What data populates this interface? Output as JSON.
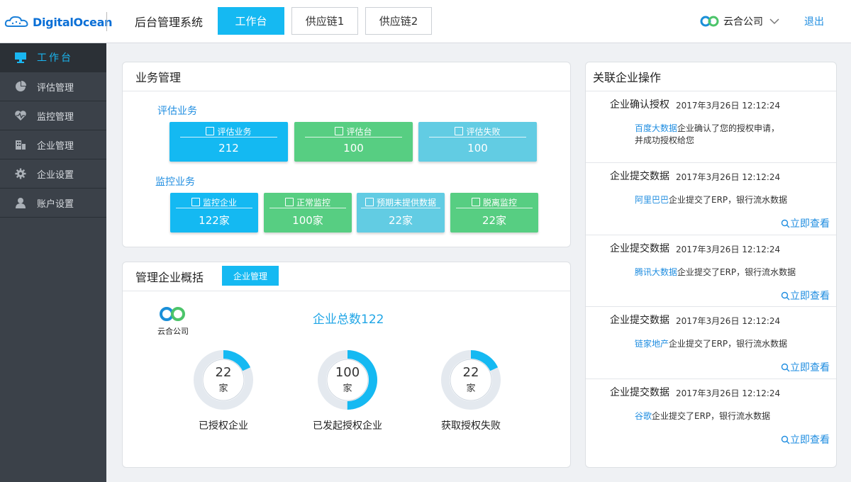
{
  "header": {
    "logo_text": "DigitalOcean",
    "system_title": "后台管理系统",
    "tabs": [
      "工作台",
      "供应链1",
      "供应链2"
    ],
    "company": "云合公司",
    "logout": "退出"
  },
  "sidebar": {
    "items": [
      {
        "label": "工作台",
        "icon": "monitor-icon"
      },
      {
        "label": "评估管理",
        "icon": "pie-chart-icon"
      },
      {
        "label": "监控管理",
        "icon": "heart-pulse-icon"
      },
      {
        "label": "企业管理",
        "icon": "building-icon"
      },
      {
        "label": "企业设置",
        "icon": "gear-icon"
      },
      {
        "label": "账户设置",
        "icon": "user-icon"
      }
    ]
  },
  "business": {
    "title": "业务管理",
    "eval_label": "评估业务",
    "eval_tiles": [
      {
        "label": "评估业务",
        "value": "212"
      },
      {
        "label": "评估台",
        "value": "100"
      },
      {
        "label": "评估失败",
        "value": "100"
      }
    ],
    "monitor_label": "监控业务",
    "monitor_tiles": [
      {
        "label": "监控企业",
        "value": "122家"
      },
      {
        "label": "正常监控",
        "value": "100家"
      },
      {
        "label": "预期未提供数据",
        "value": "22家"
      },
      {
        "label": "脱离监控",
        "value": "22家"
      }
    ]
  },
  "overview": {
    "title": "管理企业概括",
    "tab": "企业管理",
    "logo_caption": "云合公司",
    "total": "企业总数122",
    "stats": [
      {
        "num": "22",
        "unit": "家",
        "label": "已授权企业",
        "fraction": 0.18
      },
      {
        "num": "100",
        "unit": "家",
        "label": "已发起授权企业",
        "fraction": 0.5
      },
      {
        "num": "22",
        "unit": "家",
        "label": "获取授权失败",
        "fraction": 0.18
      }
    ]
  },
  "related": {
    "title": "关联企业操作",
    "items": [
      {
        "title": "企业确认授权",
        "time": "2017年3月26日  12:12:24",
        "link": "百度大数据",
        "msg": "企业确认了您的授权申请，",
        "msg2": "并成功授权给您",
        "view": ""
      },
      {
        "title": "企业提交数据",
        "time": "2017年3月26日  12:12:24",
        "link": "阿里巴巴",
        "msg": "企业提交了ERP，银行流水数据",
        "msg2": "",
        "view": "立即查看"
      },
      {
        "title": "企业提交数据",
        "time": "2017年3月26日  12:12:24",
        "link": "腾讯大数据",
        "msg": "企业提交了ERP，银行流水数据",
        "msg2": "",
        "view": "立即查看"
      },
      {
        "title": "企业提交数据",
        "time": "2017年3月26日  12:12:24",
        "link": "链家地产",
        "msg": "企业提交了ERP，银行流水数据",
        "msg2": "",
        "view": "立即查看"
      },
      {
        "title": "企业提交数据",
        "time": "2017年3月26日  12:12:24",
        "link": "谷歌",
        "msg": "企业提交了ERP，银行流水数据",
        "msg2": "",
        "view": "立即查看"
      }
    ]
  },
  "colors": {
    "accent": "#15b9f2",
    "green": "#57ce82",
    "light_blue": "#62cce3",
    "sidebar": "#3b4149"
  }
}
